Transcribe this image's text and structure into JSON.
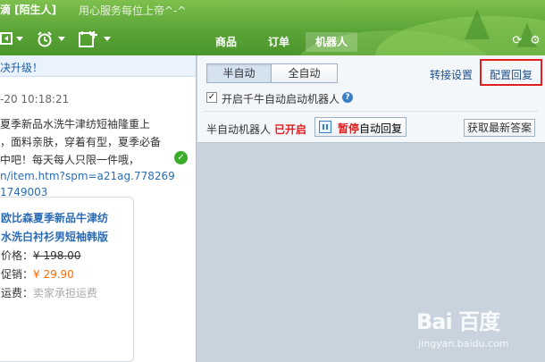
{
  "header": {
    "title_name": "滴 [陌生人]",
    "signature": "用心服务每位上帝^-^",
    "tools": [
      {
        "icon": "share-screen-icon"
      },
      {
        "icon": "alarm-icon"
      },
      {
        "icon": "calendar-add-icon"
      }
    ],
    "tabs": [
      {
        "label": "商品",
        "active": false
      },
      {
        "label": "订单",
        "active": false
      },
      {
        "label": "机器人",
        "active": true
      }
    ],
    "right_icons": [
      "refresh-icon",
      "settings-icon"
    ]
  },
  "chat": {
    "notice": "决升级！",
    "timestamp": "-20 10:18:21",
    "message_lines": [
      "夏季新品水洗牛津纺短袖隆重上",
      "，面料亲肤，穿着有型，夏季必备",
      "中吧！每天每人只限一件哦，"
    ],
    "link_lines": [
      "n/item.htm?spm=a21ag.778269",
      "1749003"
    ],
    "product": {
      "title_lines": [
        "欧比森夏季新品牛津纺",
        "水洗白衬衫男短袖韩版"
      ],
      "price_label": "价格：",
      "price_value": "¥ 198.00",
      "promo_label": "促销：",
      "promo_value": "¥ 29.90",
      "shipping_label": "运费：",
      "shipping_value": "卖家承担运费"
    }
  },
  "robot": {
    "modes": [
      {
        "label": "半自动",
        "active": true
      },
      {
        "label": "全自动",
        "active": false
      }
    ],
    "transfer_settings": "转接设置",
    "config_reply": "配置回复",
    "auto_start_label": "开启千牛自动启动机器人",
    "auto_start_checked": true,
    "status_label": "半自动机器人",
    "status_value": "已开启",
    "pause_label_bold": "暂停",
    "pause_label_rest": "自动回复",
    "get_latest": "获取最新答案"
  },
  "watermark": {
    "brand": "Bai 百度",
    "sub": "jingyan.baidu.com"
  }
}
